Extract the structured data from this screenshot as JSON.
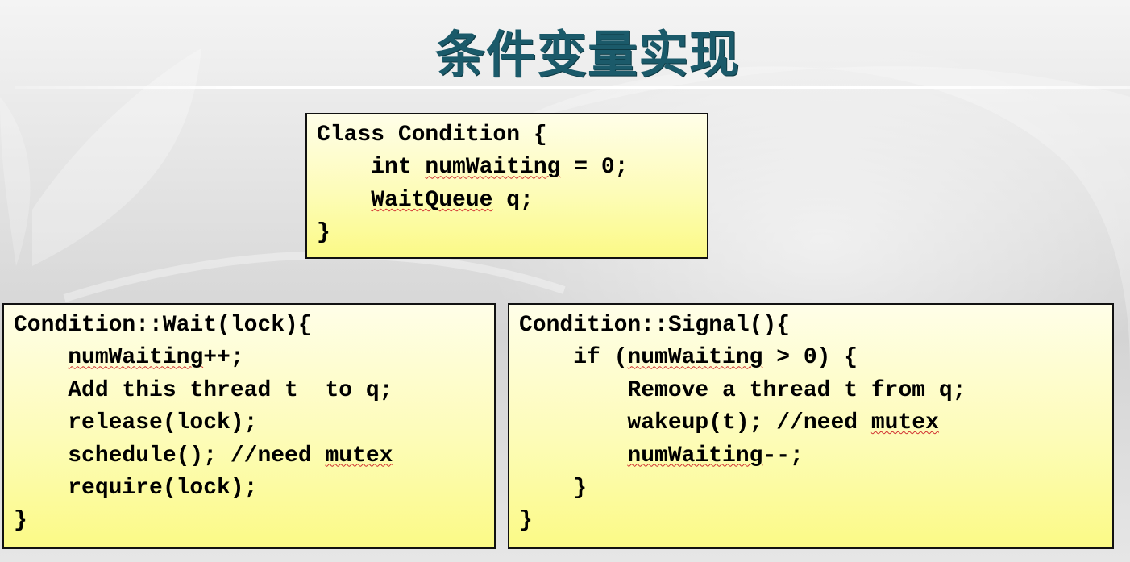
{
  "slide": {
    "title": "条件变量实现"
  },
  "class_box": {
    "lines": [
      {
        "pre": "Class Condition {",
        "sq": "",
        "post": ""
      },
      {
        "pre": "    int ",
        "sq": "numWaiting",
        "post": " = 0;"
      },
      {
        "pre": "    ",
        "sq": "WaitQueue",
        "post": " q;"
      },
      {
        "pre": "}",
        "sq": "",
        "post": ""
      }
    ]
  },
  "wait_box": {
    "lines": [
      {
        "pre": "Condition::Wait(lock){",
        "sq": "",
        "post": ""
      },
      {
        "pre": "    ",
        "sq": "numWaiting",
        "post": "++;"
      },
      {
        "pre": "    Add this thread t  to q;",
        "sq": "",
        "post": ""
      },
      {
        "pre": "    release(lock);",
        "sq": "",
        "post": ""
      },
      {
        "pre": "    schedule(); //need ",
        "sq": "mutex",
        "post": ""
      },
      {
        "pre": "    require(lock);",
        "sq": "",
        "post": ""
      },
      {
        "pre": "}",
        "sq": "",
        "post": ""
      }
    ]
  },
  "signal_box": {
    "lines": [
      {
        "pre": "Condition::Signal(){",
        "sq": "",
        "post": ""
      },
      {
        "pre": "    if (",
        "sq": "numWaiting",
        "post": " > 0) {"
      },
      {
        "pre": "        Remove a thread t from q;",
        "sq": "",
        "post": ""
      },
      {
        "pre": "        wakeup(t); //need ",
        "sq": "mutex",
        "post": ""
      },
      {
        "pre": "        ",
        "sq": "numWaiting",
        "post": "--;"
      },
      {
        "pre": "    }",
        "sq": "",
        "post": ""
      },
      {
        "pre": "}",
        "sq": "",
        "post": ""
      }
    ]
  },
  "colors": {
    "title": "#1b5a6a",
    "box_top": "#fffee8",
    "box_bottom": "#fbfa86",
    "spellcheck_underline": "#d03030"
  }
}
